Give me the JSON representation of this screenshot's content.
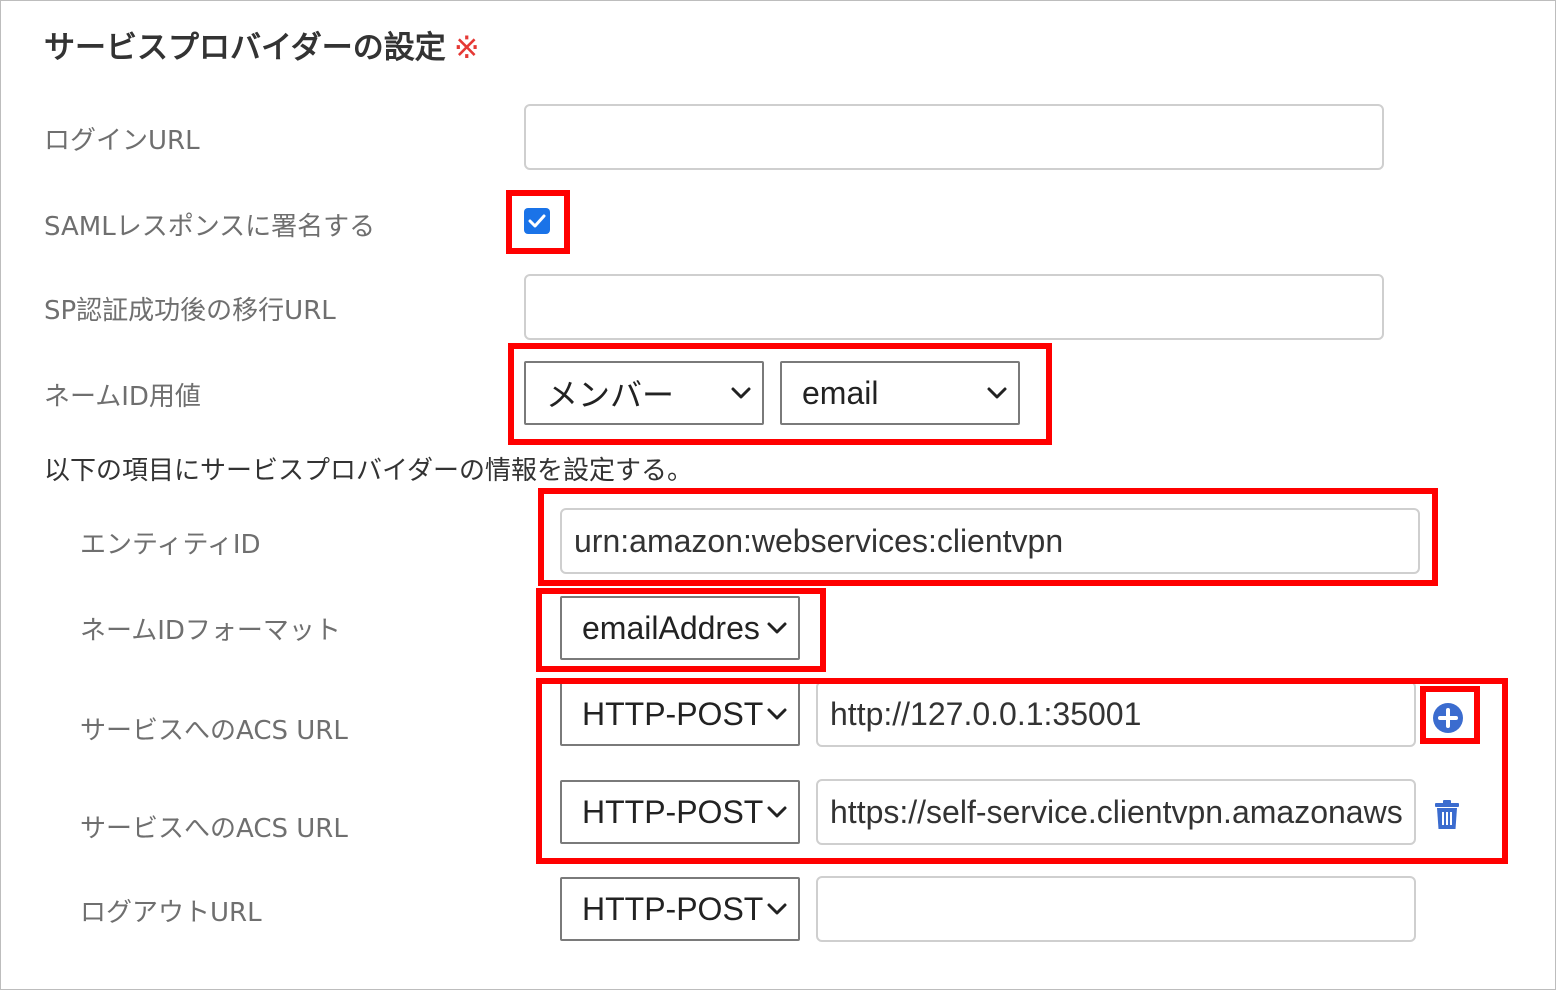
{
  "section": {
    "title": "サービスプロバイダーの設定",
    "required_mark": "※"
  },
  "fields": {
    "login_url": {
      "label": "ログインURL",
      "value": ""
    },
    "sign_saml": {
      "label": "SAMLレスポンスに署名する",
      "checked": true
    },
    "sp_redirect_url": {
      "label": "SP認証成功後の移行URL",
      "value": ""
    },
    "name_id_value": {
      "label": "ネームID用値",
      "select1": "メンバー",
      "select2": "email"
    },
    "info_text": "以下の項目にサービスプロバイダーの情報を設定する。",
    "entity_id": {
      "label": "エンティティID",
      "value": "urn:amazon:webservices:clientvpn"
    },
    "name_id_format": {
      "label": "ネームIDフォーマット",
      "value": "emailAddres"
    },
    "acs_url_1": {
      "label": "サービスへのACS URL",
      "binding": "HTTP-POST",
      "value": "http://127.0.0.1:35001"
    },
    "acs_url_2": {
      "label": "サービスへのACS URL",
      "binding": "HTTP-POST",
      "value": "https://self-service.clientvpn.amazonaws"
    },
    "logout_url": {
      "label": "ログアウトURL",
      "binding": "HTTP-POST",
      "value": ""
    }
  },
  "icons": {
    "add": "plus-circle-icon",
    "delete": "trash-icon",
    "chevron": "chevron-down-icon",
    "check": "checkmark-icon"
  },
  "colors": {
    "highlight": "#ff0000",
    "accent": "#1a73e8",
    "add_icon": "#3b6ccf",
    "delete_icon": "#3b6ccf",
    "required": "#e53935"
  }
}
